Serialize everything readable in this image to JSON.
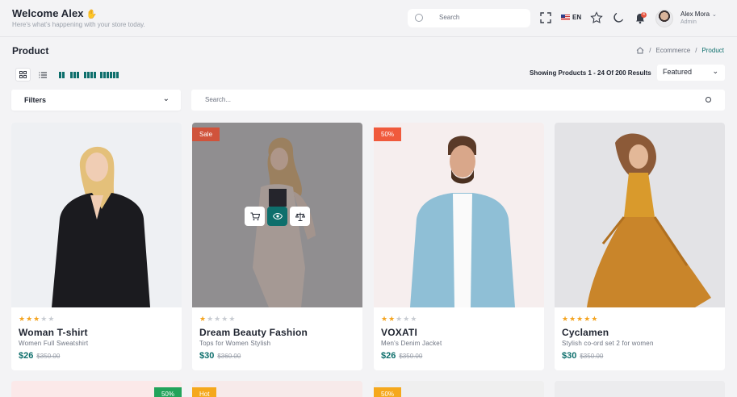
{
  "header": {
    "welcome_title": "Welcome Alex",
    "welcome_subtitle": "Here's what's happening with your store today.",
    "search_placeholder": "Search",
    "language": "EN",
    "notification_count": "4",
    "user_name": "Alex Mora",
    "user_role": "Admin"
  },
  "page": {
    "title": "Product",
    "breadcrumb": [
      "Ecommerce",
      "Product"
    ]
  },
  "toolbar": {
    "showing_text": "Showing Products 1 - 24 Of 200 Results",
    "sort_selected": "Featured",
    "filters_label": "Filters",
    "search_placeholder": "Search..."
  },
  "colors": {
    "accent": "#0e6f6c",
    "sale_badge": "#d0533b",
    "percent_badge": "#f05a3c",
    "green_badge": "#22a35a",
    "hot_badge": "#f5a81c",
    "star": "#f4a420"
  },
  "products": [
    {
      "name": "Woman T-shirt",
      "desc": "Women Full Sweatshirt",
      "price": "$26",
      "old_price": "$350.00",
      "rating": 3,
      "badge": ""
    },
    {
      "name": "Dream Beauty Fashion",
      "desc": "Tops for Women Stylish",
      "price": "$30",
      "old_price": "$360.00",
      "rating": 1,
      "badge": "Sale"
    },
    {
      "name": "VOXATI",
      "desc": "Men's Denim Jacket",
      "price": "$26",
      "old_price": "$350.00",
      "rating": 2,
      "badge": "50%"
    },
    {
      "name": "Cyclamen",
      "desc": "Stylish co-ord set 2 for women",
      "price": "$30",
      "old_price": "$350.00",
      "rating": 5,
      "badge": ""
    }
  ],
  "second_row_badges": [
    "50%",
    "Hot",
    "50%"
  ],
  "icons": [
    "search-icon",
    "fullscreen-icon",
    "star-icon",
    "moon-icon",
    "bell-icon",
    "home-icon",
    "grid-icon",
    "list-icon",
    "cart-icon",
    "eye-icon",
    "compare-icon"
  ]
}
